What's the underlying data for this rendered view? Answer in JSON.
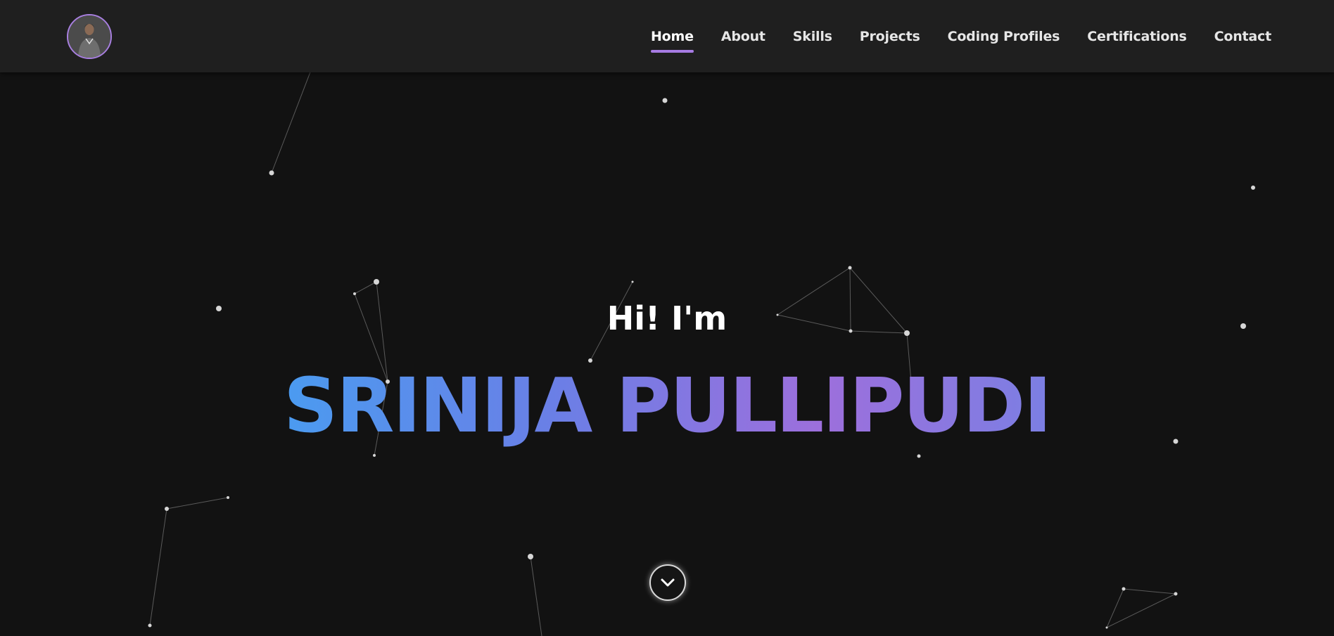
{
  "nav": {
    "logo": "avatar",
    "links": [
      {
        "label": "Home",
        "active": true
      },
      {
        "label": "About",
        "active": false
      },
      {
        "label": "Skills",
        "active": false
      },
      {
        "label": "Projects",
        "active": false
      },
      {
        "label": "Coding Profiles",
        "active": false
      },
      {
        "label": "Certifications",
        "active": false
      },
      {
        "label": "Contact",
        "active": false
      }
    ]
  },
  "hero": {
    "greeting": "Hi! I'm",
    "name": "SRINIJA PULLIPUDI",
    "scroll_icon": "chevron-down-icon"
  },
  "colors": {
    "background": "#121212",
    "navbar": "#1f1f1f",
    "accent": "#a77be3",
    "gradient_start": "#4b9bf0",
    "gradient_end": "#9d6fdc"
  }
}
